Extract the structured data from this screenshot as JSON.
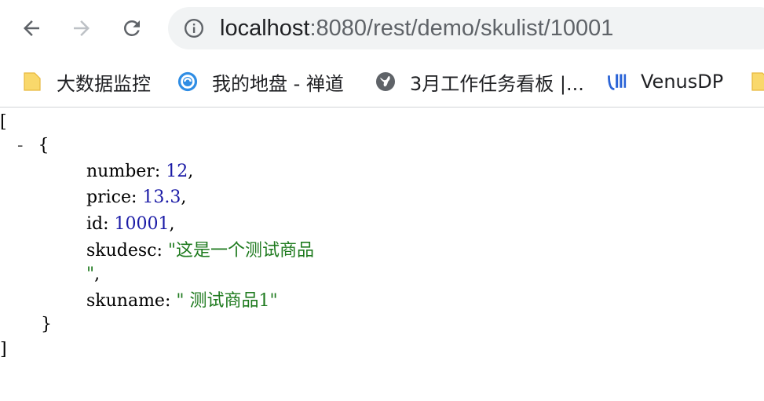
{
  "browser": {
    "back_icon": "arrow-left-icon",
    "forward_icon": "arrow-right-icon",
    "reload_icon": "reload-icon",
    "site_info_icon": "info-icon",
    "url_host": "localhost",
    "url_path": ":8080/rest/demo/skulist/10001"
  },
  "bookmarks": [
    {
      "label": "大数据监控",
      "icon": "folder-icon"
    },
    {
      "label": "我的地盘 - 禅道",
      "icon": "zentao-icon"
    },
    {
      "label": "3月工作任务看板 |...",
      "icon": "globe-icon"
    },
    {
      "label": "VenusDP",
      "icon": "venusdp-icon"
    }
  ],
  "json_view": {
    "open_bracket": "[",
    "close_bracket": "]",
    "collapse_toggle": "-",
    "open_brace": "{",
    "close_brace": "}",
    "fields": {
      "number": {
        "key": "number",
        "value": "12"
      },
      "price": {
        "key": "price",
        "value": "13.3"
      },
      "id": {
        "key": "id",
        "value": "10001"
      },
      "skudesc": {
        "key": "skudesc",
        "value_line1": "\"这是一个测试商品",
        "value_line2": "\""
      },
      "skuname": {
        "key": "skuname",
        "value": "\" 测试商品1\""
      }
    }
  },
  "colors": {
    "number_value": "#1a1aa6",
    "string_value": "#1e7a1e",
    "omnibox_bg": "#f1f3f4"
  }
}
